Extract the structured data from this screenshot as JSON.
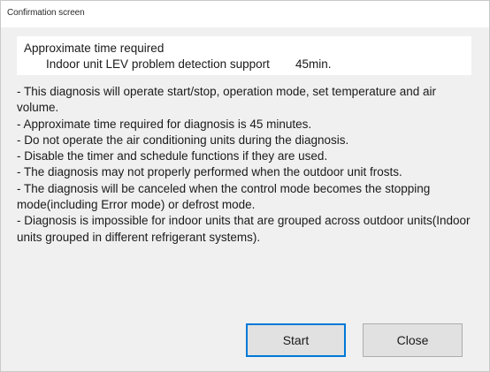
{
  "window": {
    "title": "Confirmation screen"
  },
  "time_panel": {
    "heading": "Approximate time required",
    "item_label": "Indoor unit LEV problem detection support",
    "item_value": "45min."
  },
  "notes": [
    "- This diagnosis will operate start/stop, operation mode, set temperature and air volume.",
    "- Approximate time required for diagnosis is 45 minutes.",
    "- Do not operate the air conditioning units during the diagnosis.",
    "- Disable the timer and schedule functions if they are used.",
    "- The diagnosis may not properly performed when the outdoor unit frosts.",
    "- The diagnosis will be canceled when the control mode becomes the stopping mode(including Error mode) or defrost mode.",
    "- Diagnosis is impossible for indoor units that are grouped across outdoor units(Indoor units grouped in different refrigerant systems)."
  ],
  "buttons": {
    "start_label": "Start",
    "close_label": "Close"
  },
  "colors": {
    "focus_border": "#0078d7",
    "dialog_background": "#f0f0f0",
    "panel_background": "#ffffff"
  }
}
